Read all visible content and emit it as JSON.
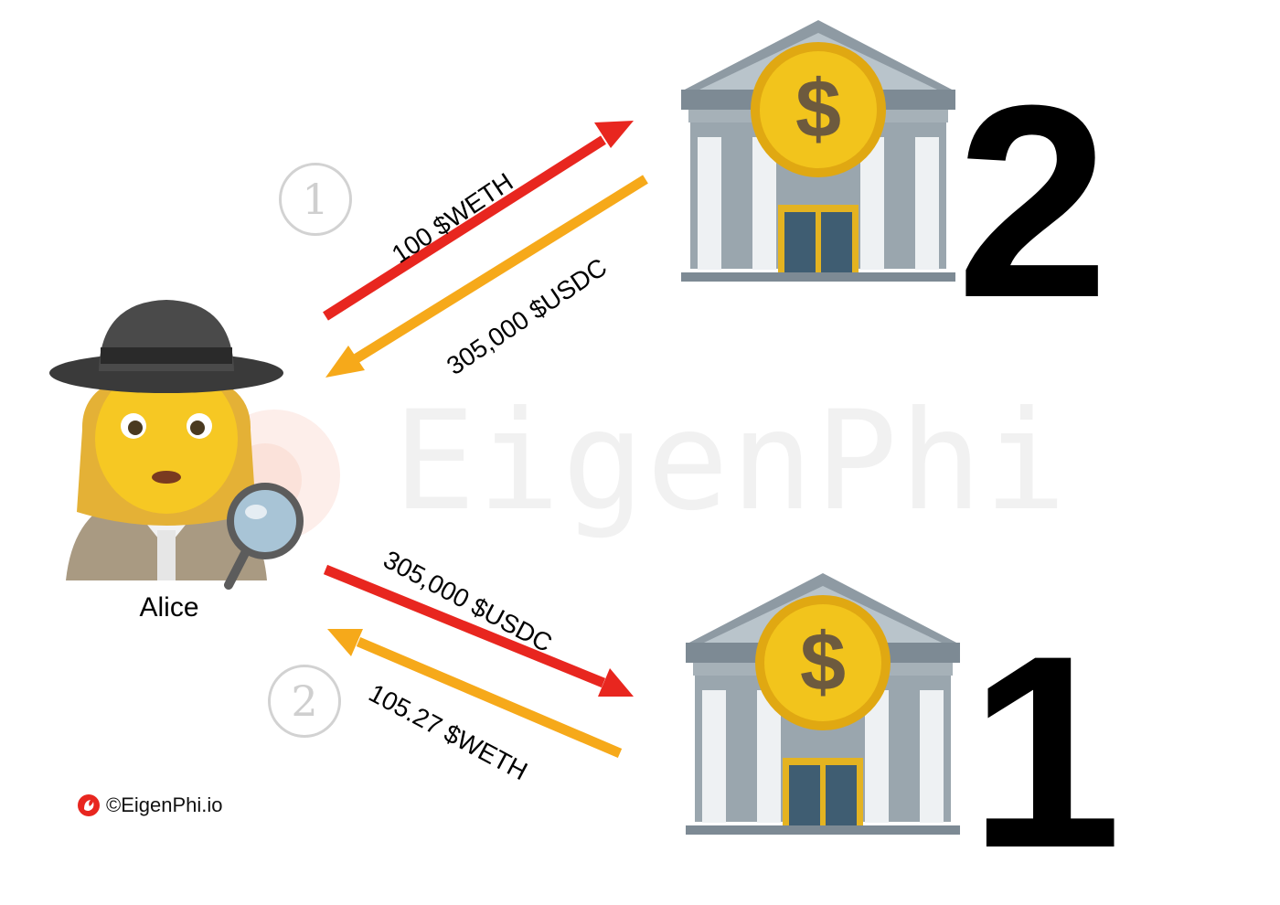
{
  "watermark": {
    "text": "EigenPhi"
  },
  "actor": {
    "name": "Alice"
  },
  "banks": [
    {
      "number": "2",
      "icon": "bank-icon"
    },
    {
      "number": "1",
      "icon": "bank-icon"
    }
  ],
  "steps": [
    {
      "number": "1",
      "label": "step-one"
    },
    {
      "number": "2",
      "label": "step-two"
    }
  ],
  "flows": [
    {
      "label": "100 $WETH",
      "color": "#e8261f",
      "direction": "Alice to bank 2"
    },
    {
      "label": "305,000 $USDC",
      "color": "#f6a91a",
      "direction": "bank 2 to Alice"
    },
    {
      "label": "305,000 $USDC",
      "color": "#e8261f",
      "direction": "Alice to bank 1"
    },
    {
      "label": "105.27 $WETH",
      "color": "#f6a91a",
      "direction": "bank 1 to Alice"
    }
  ],
  "footer": {
    "copyright": "©EigenPhi.io",
    "logo_icon": "eigenphi-logo-icon"
  },
  "colors": {
    "accent_red": "#e8261f",
    "accent_orange": "#f6a91a",
    "coin_gold": "#f2c41c"
  }
}
